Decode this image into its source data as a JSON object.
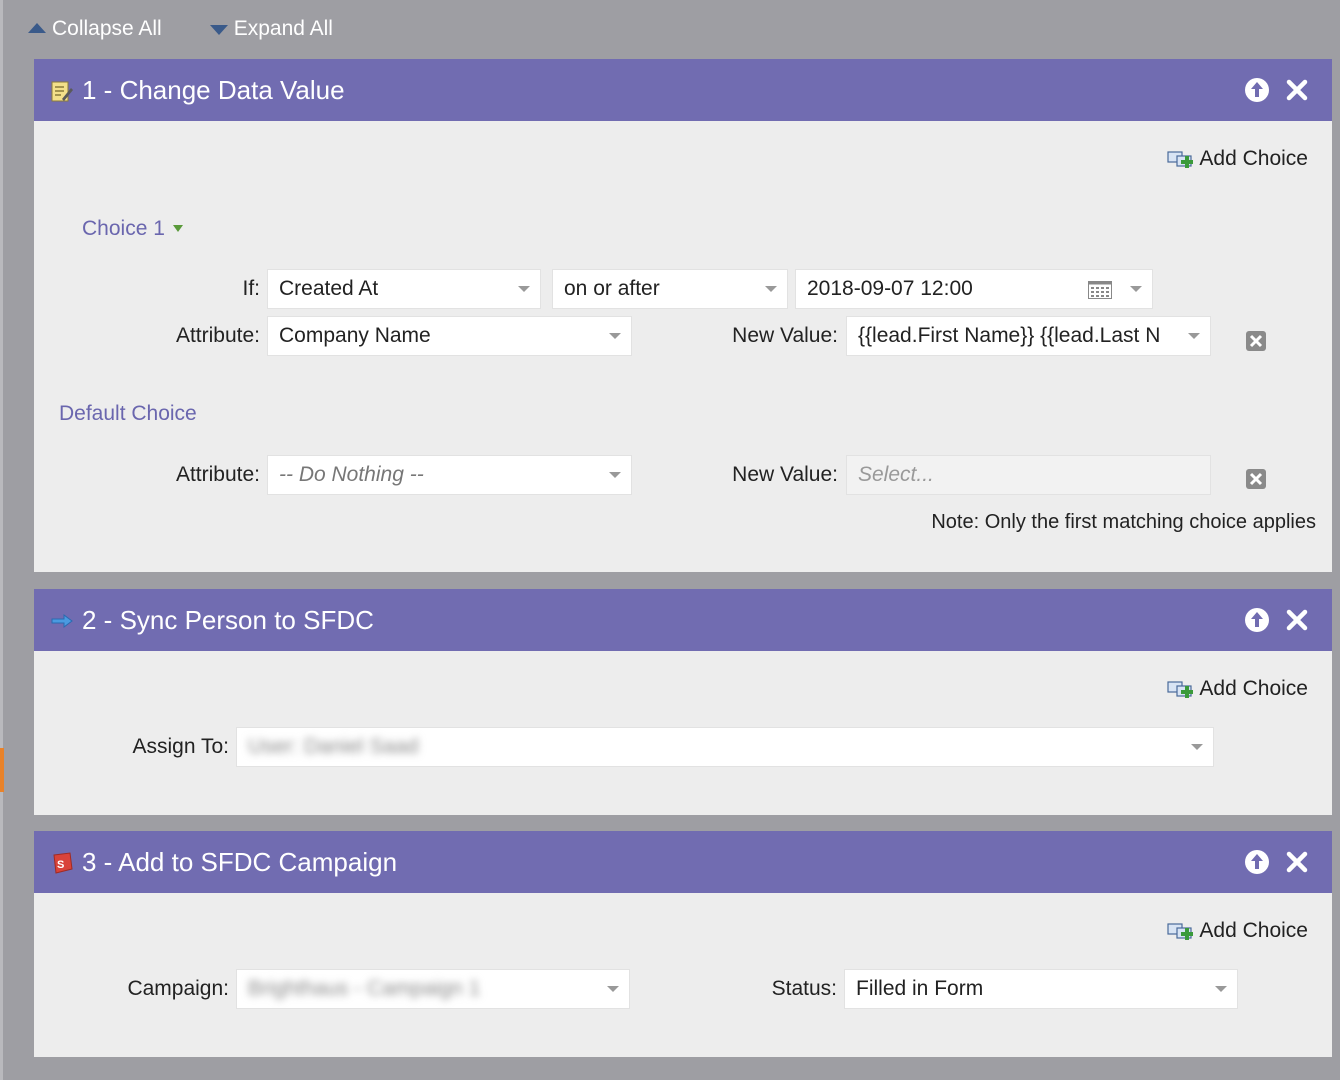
{
  "toolbar": {
    "collapse_all": "Collapse All",
    "expand_all": "Expand All"
  },
  "flow_steps": [
    {
      "title": "1 - Change Data Value",
      "add_choice": "Add Choice",
      "choice_label": "Choice 1",
      "if_label": "If:",
      "if_field": "Created At",
      "if_operator": "on or after",
      "if_value": "2018-09-07 12:00",
      "attribute_label": "Attribute:",
      "attribute_value": "Company Name",
      "new_value_label": "New Value:",
      "new_value": "{{lead.First Name}} {{lead.Last N",
      "default_choice_label": "Default Choice",
      "default_attribute_label": "Attribute:",
      "default_attribute_value": "-- Do Nothing --",
      "default_new_value_label": "New Value:",
      "default_new_value_placeholder": "Select...",
      "note": "Note: Only the first matching choice applies"
    },
    {
      "title": "2 - Sync Person to SFDC",
      "add_choice": "Add Choice",
      "assign_to_label": "Assign To:",
      "assign_to_value": "User: Daniel Saad"
    },
    {
      "title": "3 - Add to SFDC Campaign",
      "add_choice": "Add Choice",
      "campaign_label": "Campaign:",
      "campaign_value": "Brighthaus - Campaign 1",
      "status_label": "Status:",
      "status_value": "Filled in Form"
    }
  ],
  "colors": {
    "header": "#716cb1",
    "panel_bg": "#ededed",
    "page_bg": "#9e9ea3",
    "link": "#6a66ae"
  }
}
